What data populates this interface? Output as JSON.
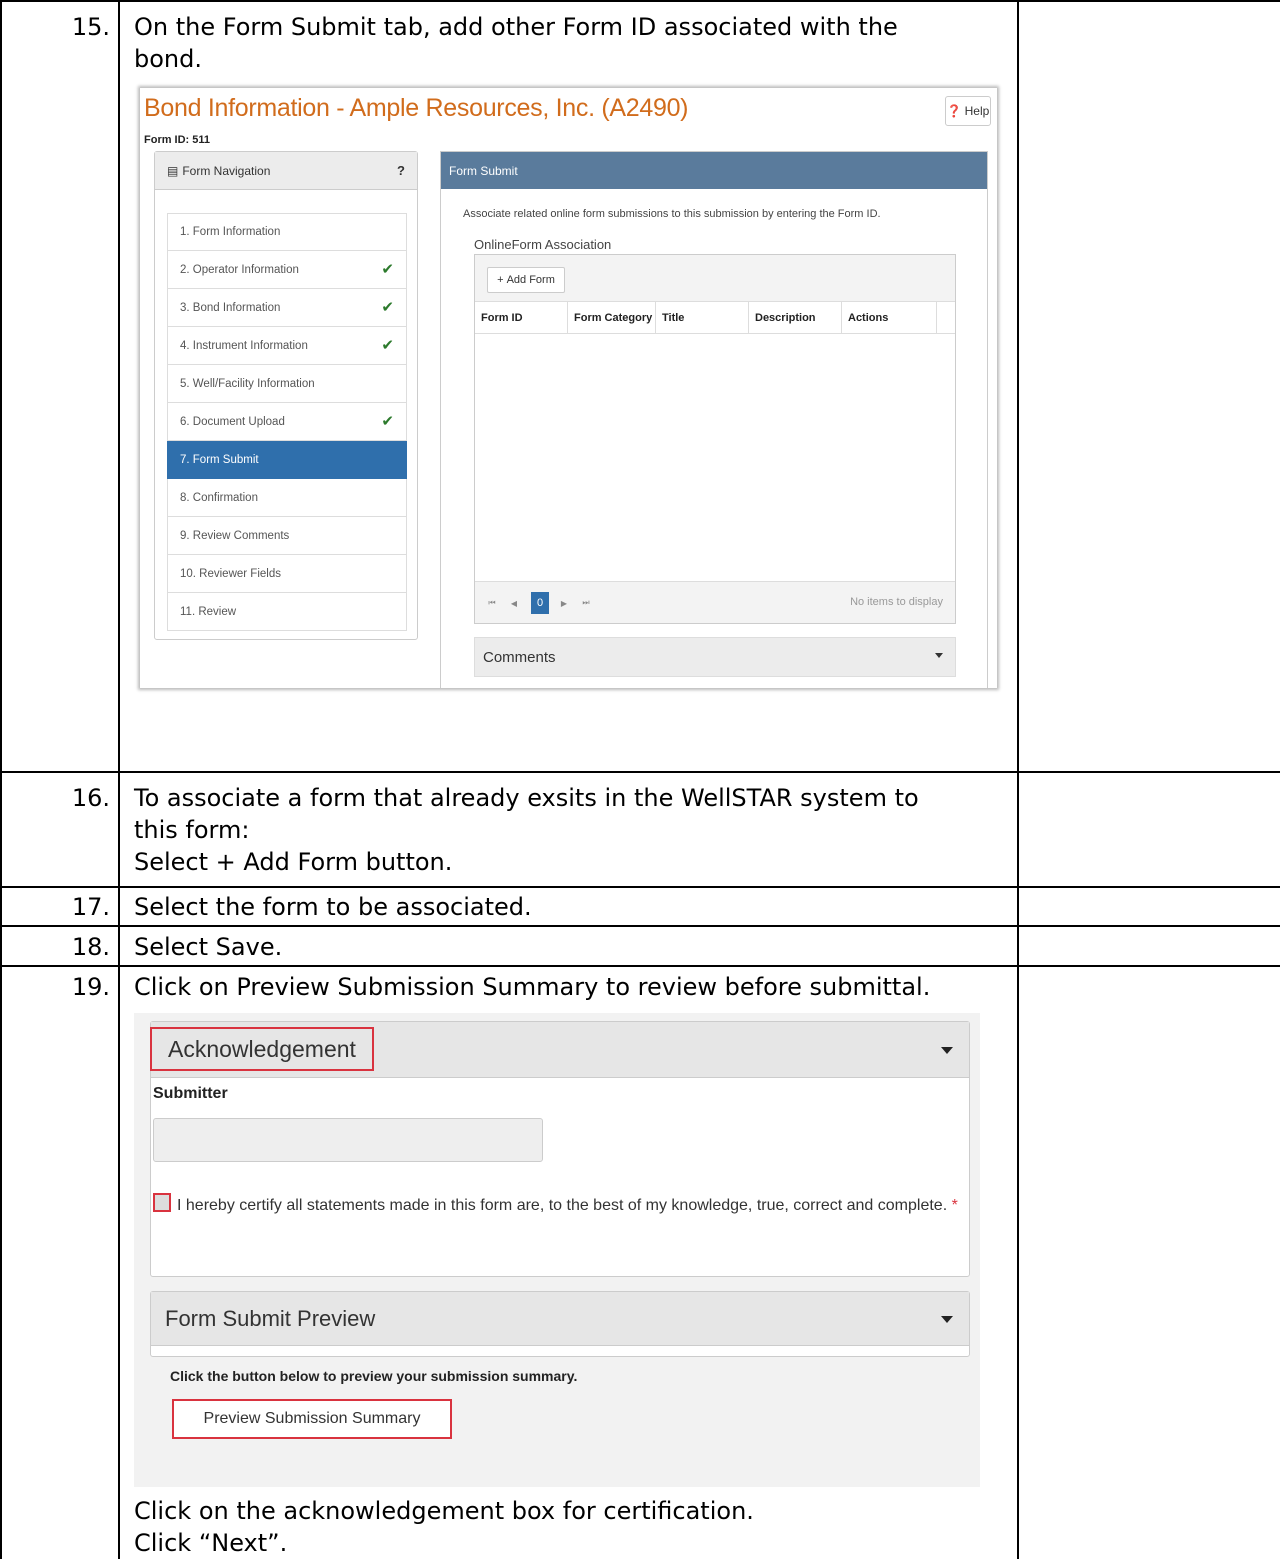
{
  "steps": [
    {
      "num": "15.",
      "lines": [
        "On the Form Submit tab, add other Form ID associated with the",
        "bond."
      ]
    },
    {
      "num": "16.",
      "lines": [
        "To associate a form that already exsits in the WellSTAR system to",
        "this form:",
        "Select + Add Form button."
      ]
    },
    {
      "num": "17.",
      "lines": [
        "Select the form to be associated."
      ]
    },
    {
      "num": "18.",
      "lines": [
        "Select Save."
      ]
    },
    {
      "num": "19.",
      "lines": [
        "Click on Preview Submission Summary to review before submittal."
      ]
    }
  ],
  "step19_after": [
    "Click on the acknowledgement box for certification.",
    "Click “Next”."
  ],
  "shot1": {
    "title": "Bond Information - Ample Resources, Inc. (A2490)",
    "help": "Help",
    "form_id": "Form ID: 511",
    "nav_title": "Form Navigation",
    "nav_items": [
      {
        "label": "1. Form Information",
        "check": false
      },
      {
        "label": "2. Operator Information",
        "check": true
      },
      {
        "label": "3. Bond Information",
        "check": true
      },
      {
        "label": "4. Instrument Information",
        "check": true
      },
      {
        "label": "5. Well/Facility Information",
        "check": false
      },
      {
        "label": "6. Document Upload",
        "check": true
      },
      {
        "label": "7. Form Submit",
        "check": false,
        "active": true
      },
      {
        "label": "8. Confirmation",
        "check": false
      },
      {
        "label": "9. Review Comments",
        "check": false
      },
      {
        "label": "10. Reviewer Fields",
        "check": false
      },
      {
        "label": "11. Review",
        "check": false
      }
    ],
    "panel_title": "Form Submit",
    "description": "Associate related online form submissions to this submission by entering the Form ID.",
    "association_label": "OnlineForm Association",
    "add_form": "Add Form",
    "columns": [
      "Form ID",
      "Form Category",
      "Title",
      "Description",
      "Actions"
    ],
    "page": "0",
    "no_items": "No items to display",
    "comments": "Comments"
  },
  "shot2": {
    "ack_title": "Acknowledgement",
    "submitter_label": "Submitter",
    "ack_text": "I hereby certify all statements made in this form are, to the best of my knowledge, true, correct and complete.",
    "required_mark": "*",
    "preview_title": "Form Submit Preview",
    "preview_desc": "Click the button below to preview your submission summary.",
    "preview_button": "Preview Submission Summary"
  },
  "colors": {
    "title_orange": "#d16c1c",
    "nav_active": "#2f6fac",
    "panel_head": "#5a7b9c",
    "highlight_red": "#d9333f",
    "check_green": "#2c7a2c"
  }
}
